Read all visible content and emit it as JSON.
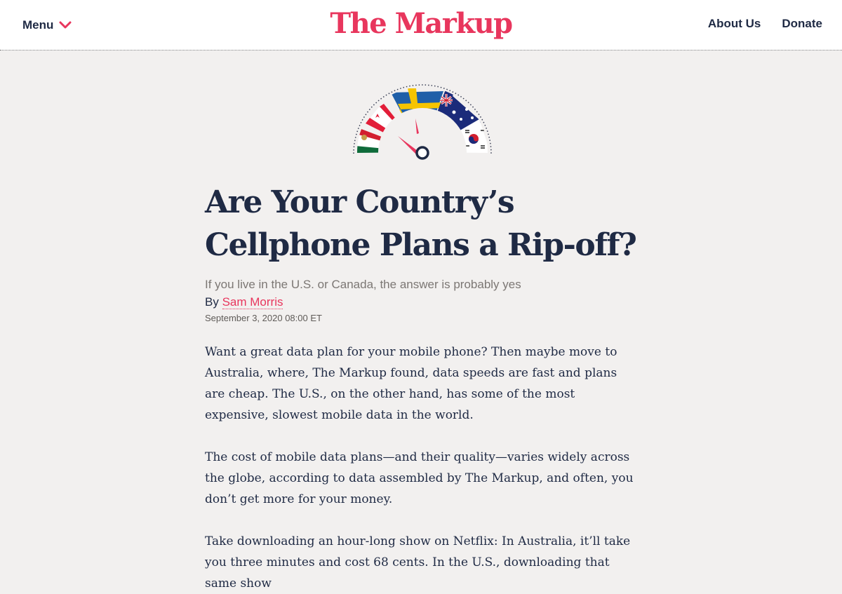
{
  "header": {
    "menu_label": "Menu",
    "logo_text": "The Markup",
    "nav": [
      {
        "label": "About Us"
      },
      {
        "label": "Donate"
      }
    ]
  },
  "colors": {
    "brand": "#e8365d",
    "headline": "#1f2a44",
    "background": "#f2f0ef"
  },
  "hero_illustration": {
    "type": "speedometer-gauge",
    "flags": [
      "mexico",
      "canada",
      "sweden",
      "australia",
      "south-korea"
    ]
  },
  "article": {
    "headline": "Are Your Country’s Cellphone Plans a Rip-off?",
    "dek": "If you live in the U.S. or Canada, the answer is probably yes",
    "byline_prefix": "By",
    "author": "Sam Morris",
    "date": "September 3, 2020 08:00 ET",
    "paragraphs": [
      "Want a great data plan for your mobile phone? Then maybe move to Australia, where, The Markup found, data speeds are fast and plans are cheap. The U.S., on the other hand, has some of the most expensive, slowest mobile data in the world.",
      "The cost of mobile data plans—and their quality—varies widely across the globe, according to data assembled by The Markup, and often, you don’t get more for your money.",
      "Take downloading an hour-long show on Netflix: In Australia, it’ll take you three minutes and cost 68 cents. In the U.S., downloading that same show"
    ]
  }
}
